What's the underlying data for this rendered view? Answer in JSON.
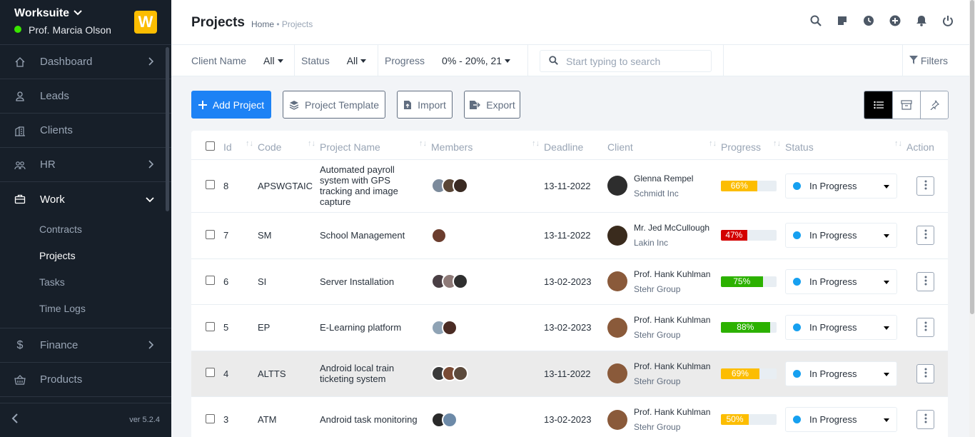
{
  "app": {
    "name": "Worksuite",
    "user": "Prof. Marcia Olson",
    "logo_letter": "W",
    "version": "ver 5.2.4"
  },
  "sidebar": {
    "items": [
      {
        "label": "Dashboard",
        "icon": "home-icon",
        "arrow": "right"
      },
      {
        "label": "Leads",
        "icon": "user-icon",
        "arrow": ""
      },
      {
        "label": "Clients",
        "icon": "building-icon",
        "arrow": ""
      },
      {
        "label": "HR",
        "icon": "people-icon",
        "arrow": "right"
      },
      {
        "label": "Work",
        "icon": "briefcase-icon",
        "arrow": "down"
      },
      {
        "label": "Finance",
        "icon": "dollar-icon",
        "arrow": "right"
      },
      {
        "label": "Products",
        "icon": "basket-icon",
        "arrow": ""
      }
    ],
    "work_sub": [
      "Contracts",
      "Projects",
      "Tasks",
      "Time Logs"
    ]
  },
  "header": {
    "title": "Projects",
    "crumb_home": "Home",
    "crumb_sep": " • ",
    "crumb_current": "Projects"
  },
  "filters": {
    "client_label": "Client Name",
    "client_value": "All",
    "status_label": "Status",
    "status_value": "All",
    "progress_label": "Progress",
    "progress_value": "0% - 20%, 21",
    "search_placeholder": "Start typing to search",
    "filters_label": "Filters"
  },
  "toolbar": {
    "add": "Add Project",
    "template": "Project Template",
    "import": "Import",
    "export": "Export"
  },
  "table": {
    "headers": [
      "Id",
      "Code",
      "Project Name",
      "Members",
      "Deadline",
      "Client",
      "Progress",
      "Status",
      "Action"
    ],
    "rows": [
      {
        "id": "8",
        "code": "APSWGTAIC",
        "name": "Automated payroll system with GPS tracking and image capture",
        "deadline": "13-11-2022",
        "client": "Glenna Rempel",
        "company": "Schmidt Inc",
        "progress": 66,
        "progress_label": "66%",
        "progress_color": "#fcbd01",
        "status": "In Progress"
      },
      {
        "id": "7",
        "code": "SM",
        "name": "School Management",
        "deadline": "13-11-2022",
        "client": "Mr. Jed McCullough",
        "company": "Lakin Inc",
        "progress": 47,
        "progress_label": "47%",
        "progress_color": "#d30000",
        "status": "In Progress"
      },
      {
        "id": "6",
        "code": "SI",
        "name": "Server Installation",
        "deadline": "13-02-2023",
        "client": "Prof. Hank Kuhlman",
        "company": "Stehr Group",
        "progress": 75,
        "progress_label": "75%",
        "progress_color": "#2cb100",
        "status": "In Progress"
      },
      {
        "id": "5",
        "code": "EP",
        "name": "E-Learning platform",
        "deadline": "13-02-2023",
        "client": "Prof. Hank Kuhlman",
        "company": "Stehr Group",
        "progress": 88,
        "progress_label": "88%",
        "progress_color": "#2cb100",
        "status": "In Progress"
      },
      {
        "id": "4",
        "code": "ALTTS",
        "name": "Android local train ticketing system",
        "deadline": "13-11-2022",
        "client": "Prof. Hank Kuhlman",
        "company": "Stehr Group",
        "progress": 69,
        "progress_label": "69%",
        "progress_color": "#fcbd01",
        "status": "In Progress"
      },
      {
        "id": "3",
        "code": "ATM",
        "name": "Android task monitoring",
        "deadline": "13-02-2023",
        "client": "Prof. Hank Kuhlman",
        "company": "Stehr Group",
        "progress": 50,
        "progress_label": "50%",
        "progress_color": "#fcbd01",
        "status": "In Progress"
      }
    ]
  }
}
